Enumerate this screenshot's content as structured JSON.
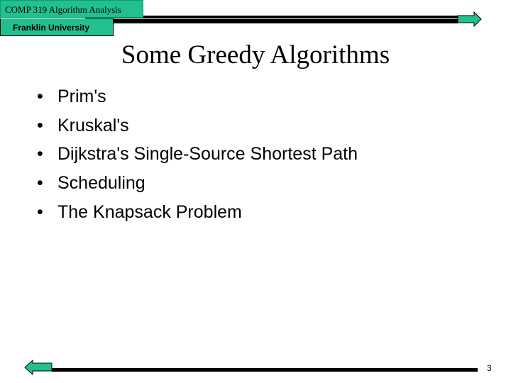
{
  "header": {
    "course": "COMP 319 Algorithm Analysis",
    "university": "Franklin University"
  },
  "slide": {
    "title": "Some Greedy Algorithms",
    "bullets": [
      "Prim's",
      "Kruskal's",
      "Dijkstra's Single-Source Shortest Path",
      "Scheduling",
      "The Knapsack Problem"
    ]
  },
  "footer": {
    "page_number": "3"
  },
  "colors": {
    "accent": "#22c08f"
  },
  "icons": {
    "next": "arrow-right-icon",
    "prev": "arrow-left-icon"
  }
}
